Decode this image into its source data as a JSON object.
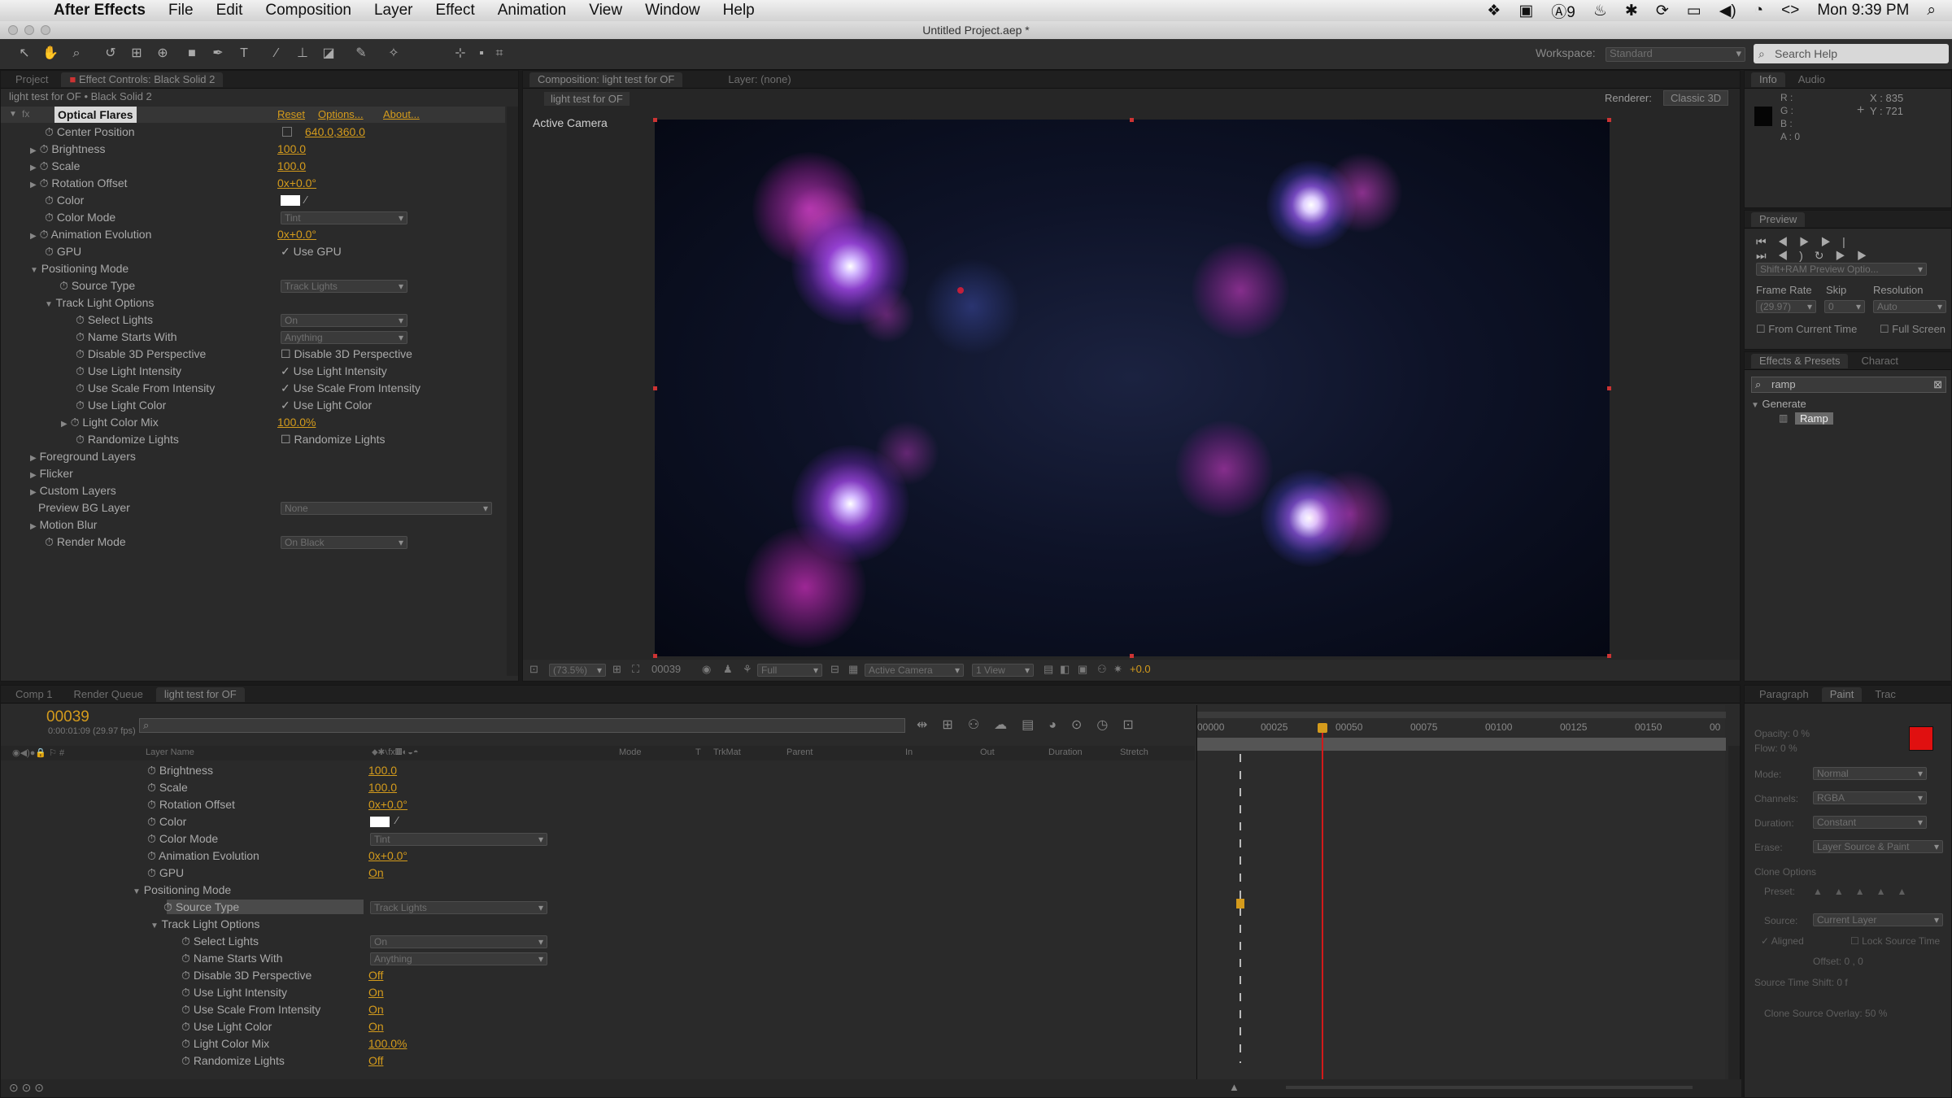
{
  "menubar": {
    "app": "After Effects",
    "items": [
      "File",
      "Edit",
      "Composition",
      "Layer",
      "Effect",
      "Animation",
      "View",
      "Window",
      "Help"
    ],
    "status": {
      "battery": "9",
      "clock": "Mon 9:39 PM"
    }
  },
  "window": {
    "title": "Untitled Project.aep *"
  },
  "toolbar": {
    "workspace_label": "Workspace:",
    "workspace_value": "Standard",
    "search_placeholder": "Search Help"
  },
  "left_panel": {
    "tabs": [
      "Project",
      "Effect Controls: Black Solid 2"
    ],
    "header": "light test for OF • Black Solid 2",
    "effect_name": "Optical Flares",
    "effect_links": [
      "Reset",
      "Options...",
      "About..."
    ],
    "props": [
      {
        "label": "Center Position",
        "value": "640.0,360.0"
      },
      {
        "label": "Brightness",
        "value": "100.0"
      },
      {
        "label": "Scale",
        "value": "100.0"
      },
      {
        "label": "Rotation Offset",
        "value": "0x+0.0°"
      },
      {
        "label": "Color",
        "value": ""
      },
      {
        "label": "Color Mode",
        "value": "Tint"
      },
      {
        "label": "Animation Evolution",
        "value": "0x+0.0°"
      },
      {
        "label": "GPU",
        "value": "Use GPU"
      },
      {
        "label": "Positioning Mode",
        "value": ""
      },
      {
        "label": "Source Type",
        "value": "Track Lights"
      },
      {
        "label": "Track Light Options",
        "value": ""
      },
      {
        "label": "Select Lights",
        "value": "On"
      },
      {
        "label": "Name Starts With",
        "value": "Anything"
      },
      {
        "label": "Disable 3D Perspective",
        "value": "Disable 3D Perspective"
      },
      {
        "label": "Use Light Intensity",
        "value": "Use Light Intensity"
      },
      {
        "label": "Use Scale From Intensity",
        "value": "Use Scale From Intensity"
      },
      {
        "label": "Use Light Color",
        "value": "Use Light Color"
      },
      {
        "label": "Light Color Mix",
        "value": "100.0%"
      },
      {
        "label": "Randomize Lights",
        "value": "Randomize Lights"
      },
      {
        "label": "Foreground Layers",
        "value": ""
      },
      {
        "label": "Flicker",
        "value": ""
      },
      {
        "label": "Custom Layers",
        "value": ""
      },
      {
        "label": "Preview BG Layer",
        "value": "None"
      },
      {
        "label": "Motion Blur",
        "value": ""
      },
      {
        "label": "Render Mode",
        "value": "On Black"
      }
    ]
  },
  "comp_panel": {
    "tabs": [
      "Composition: light test for OF",
      "Layer: (none)"
    ],
    "subtab": "light test for OF",
    "renderer_label": "Renderer:",
    "renderer_value": "Classic 3D",
    "camera_label": "Active Camera",
    "footer": {
      "zoom": "(73.5%)",
      "timecode": "00039",
      "resolution": "Full",
      "camera": "Active Camera",
      "views": "1 View",
      "exposure": "+0.0"
    }
  },
  "info_panel": {
    "tabs": [
      "Info",
      "Audio"
    ],
    "rgba": [
      "R :",
      "G :",
      "B :",
      "A : 0"
    ],
    "coords": [
      "X : 835",
      "Y : 721"
    ]
  },
  "preview_panel": {
    "tab": "Preview",
    "ram_option": "Shift+RAM Preview Optio...",
    "labels": [
      "Frame Rate",
      "Skip",
      "Resolution"
    ],
    "values": [
      "(29.97)",
      "0",
      "Auto"
    ],
    "checks": [
      "From Current Time",
      "Full Screen"
    ]
  },
  "effects_panel": {
    "tabs": [
      "Effects & Presets",
      "Charact"
    ],
    "search": "ramp",
    "group": "Generate",
    "item": "Ramp"
  },
  "timeline": {
    "tabs": [
      "Comp 1",
      "Render Queue",
      "light test for OF"
    ],
    "timecode": "00039",
    "timecode_sub": "0:00:01:09 (29.97 fps)",
    "columns": [
      "Layer Name",
      "Mode",
      "T",
      "TrkMat",
      "Parent",
      "In",
      "Out",
      "Duration",
      "Stretch"
    ],
    "ruler": [
      "00000",
      "00025",
      "00050",
      "00075",
      "00100",
      "00125",
      "00150",
      "00"
    ],
    "rows": [
      {
        "label": "Brightness",
        "value": "100.0"
      },
      {
        "label": "Scale",
        "value": "100.0"
      },
      {
        "label": "Rotation Offset",
        "value": "0x+0.0°"
      },
      {
        "label": "Color",
        "value": ""
      },
      {
        "label": "Color Mode",
        "value": "Tint"
      },
      {
        "label": "Animation Evolution",
        "value": "0x+0.0°"
      },
      {
        "label": "GPU",
        "value": "On"
      },
      {
        "label": "Positioning Mode",
        "value": ""
      },
      {
        "label": "Source Type",
        "value": "Track Lights"
      },
      {
        "label": "Track Light Options",
        "value": ""
      },
      {
        "label": "Select Lights",
        "value": "On"
      },
      {
        "label": "Name Starts With",
        "value": "Anything"
      },
      {
        "label": "Disable 3D Perspective",
        "value": "Off"
      },
      {
        "label": "Use Light Intensity",
        "value": "On"
      },
      {
        "label": "Use Scale From Intensity",
        "value": "On"
      },
      {
        "label": "Use Light Color",
        "value": "On"
      },
      {
        "label": "Light Color Mix",
        "value": "100.0%"
      },
      {
        "label": "Randomize Lights",
        "value": "Off"
      }
    ]
  },
  "paint_panel": {
    "tabs": [
      "Paragraph",
      "Paint",
      "Trac"
    ],
    "labels": [
      "Opacity: 0 %",
      "Flow: 0 %",
      "Mode:",
      "Channels:",
      "Duration:",
      "Erase:",
      "Clone Options",
      "Preset:",
      "Source:",
      "Aligned",
      "Offset: 0 , 0",
      "Source Time Shift: 0 f",
      "Clone Source Overlay: 50 %"
    ],
    "values": [
      "Normal",
      "RGBA",
      "Constant",
      "Layer Source & Paint",
      "Current Layer",
      "Lock Source Time"
    ]
  },
  "colors": {
    "accent": "#d49b1c",
    "fg_swatch": "#e01010",
    "playhead": "#d21a1a"
  }
}
